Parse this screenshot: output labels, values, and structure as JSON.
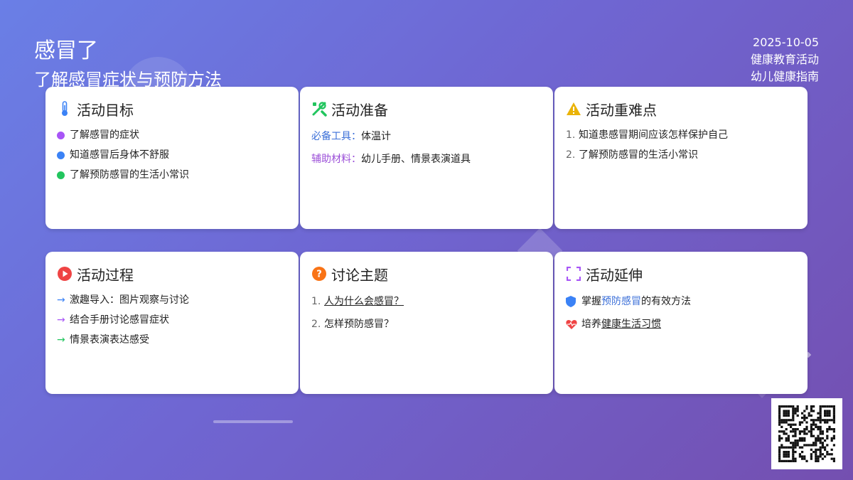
{
  "header": {
    "title": "感冒了",
    "subtitle": "了解感冒症状与预防方法",
    "date": "2025-10-05",
    "category": "健康教育活动",
    "guide": "幼儿健康指南"
  },
  "cards": {
    "goals": {
      "title": "活动目标",
      "icon": "thermometer-icon",
      "items": [
        {
          "text": "了解感冒的症状",
          "color": "#a855f7"
        },
        {
          "text": "知道感冒后身体不舒服",
          "color": "#3b82f6"
        },
        {
          "text": "了解预防感冒的生活小常识",
          "color": "#22c55e"
        }
      ]
    },
    "prep": {
      "title": "活动准备",
      "icon": "tools-icon",
      "required_label": "必备工具：",
      "required_value": "体温计",
      "aux_label": "辅助材料：",
      "aux_value": "幼儿手册、情景表演道具"
    },
    "keypoints": {
      "title": "活动重难点",
      "icon": "warning-icon",
      "items": [
        "知道患感冒期间应该怎样保护自己",
        "了解预防感冒的生活小常识"
      ]
    },
    "process": {
      "title": "活动过程",
      "icon": "play-icon",
      "items": [
        {
          "text": "激趣导入：图片观察与讨论",
          "color": "#3b82f6"
        },
        {
          "text": "结合手册讨论感冒症状",
          "color": "#a855f7"
        },
        {
          "text": "情景表演表达感受",
          "color": "#22c55e"
        }
      ]
    },
    "discussion": {
      "title": "讨论主题",
      "icon": "question-icon",
      "items": [
        "人为什么会感冒？",
        "怎样预防感冒？"
      ]
    },
    "extension": {
      "title": "活动延伸",
      "icon": "expand-icon",
      "item1_pre": "掌握",
      "item1_hl": "预防感冒",
      "item1_post": "的有效方法",
      "item2_pre": "培养",
      "item2_hl": "健康生活习惯"
    }
  },
  "colors": {
    "accent_blue": "#3b6fd8",
    "accent_purple": "#9b4fd8",
    "play_red": "#ef4444",
    "question_orange": "#f97316",
    "warning_yellow": "#eab308"
  }
}
